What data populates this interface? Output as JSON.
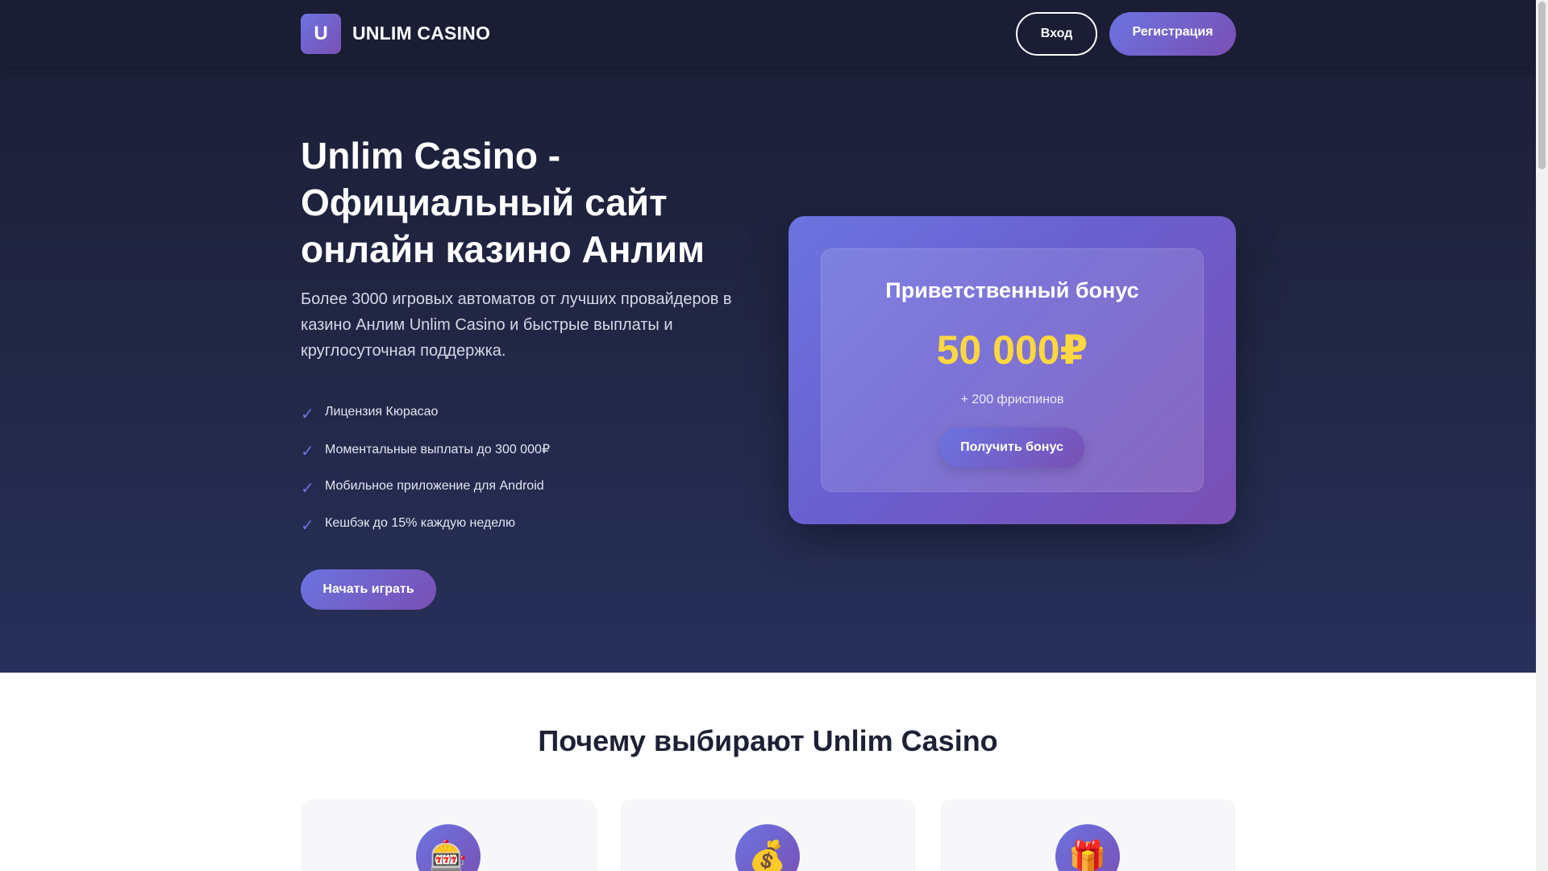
{
  "header": {
    "logo_letter": "U",
    "logo_text": "UNLIM CASINO",
    "login_label": "Вход",
    "register_label": "Регистрация"
  },
  "hero": {
    "title": "Unlim Casino - Официальный сайт онлайн казино Анлим",
    "description": "Более 3000 игровых автоматов от лучших провайдеров в казино Анлим Unlim Casino и быстрые выплаты и круглосуточная поддержка.",
    "features": [
      {
        "check": "✓",
        "text": "Лицензия Кюрасао"
      },
      {
        "check": "✓",
        "text": "Моментальные выплаты до 300 000₽"
      },
      {
        "check": "✓",
        "text": "Мобильное приложение для Android"
      },
      {
        "check": "✓",
        "text": "Кешбэк до 15% каждую неделю"
      }
    ],
    "cta_label": "Начать играть"
  },
  "bonus": {
    "title": "Приветственный бонус",
    "amount": "50 000₽",
    "spins": "+ 200 фриспинов",
    "cta_label": "Получить бонус"
  },
  "why": {
    "title": "Почему выбирают Unlim Casino",
    "cards": [
      {
        "icon": "slot-machine-icon",
        "glyph": "🎰"
      },
      {
        "icon": "money-bag-icon",
        "glyph": "💰"
      },
      {
        "icon": "gift-icon",
        "glyph": "🎁"
      }
    ]
  },
  "colors": {
    "accent_start": "#6b74e0",
    "accent_end": "#7a4fb4",
    "bonus_amount": "#ffd740",
    "hero_bg": "#1c1f37"
  }
}
